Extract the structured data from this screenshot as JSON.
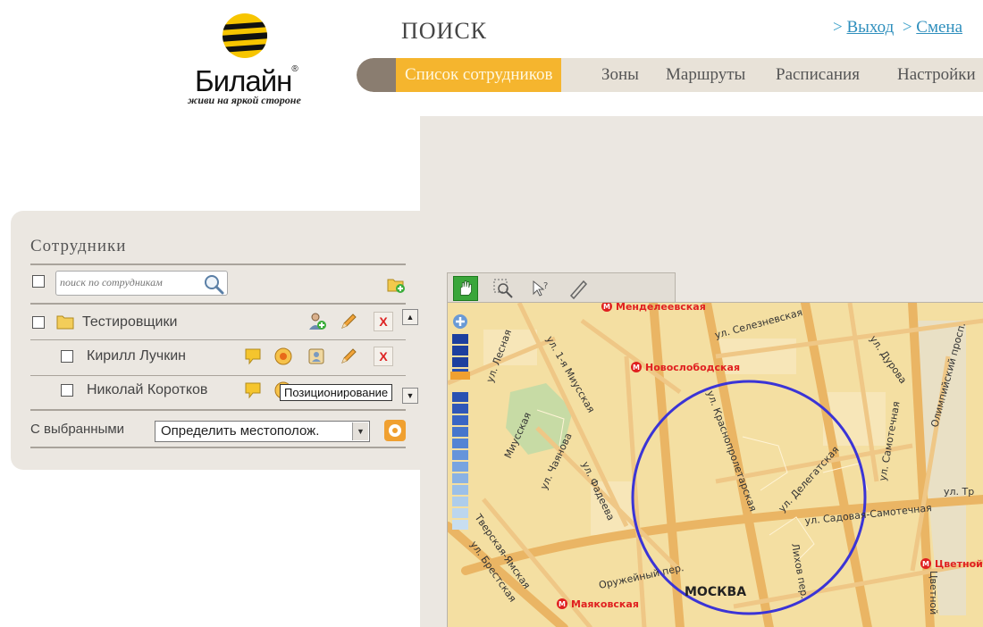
{
  "logo": {
    "brand": "Билайн",
    "reg": "®",
    "slogan": "живи на яркой стороне"
  },
  "header": {
    "title": "ПОИСК",
    "links": [
      {
        "label": "Выход"
      },
      {
        "label": "Смена"
      }
    ]
  },
  "nav": {
    "tabs": [
      {
        "label": "Список сотрудников",
        "active": true
      },
      {
        "label": "Зоны"
      },
      {
        "label": "Маршруты"
      },
      {
        "label": "Расписания"
      },
      {
        "label": "Настройки"
      }
    ]
  },
  "panel": {
    "title": "Сотрудники",
    "search": {
      "placeholder": "поиск по сотрудникам"
    },
    "group": {
      "name": "Тестировщики"
    },
    "employees": [
      {
        "name": "Кирилл Лучкин"
      },
      {
        "name": "Николай Коротков"
      }
    ],
    "tooltip": "Позиционирование",
    "with_selected_label": "С выбранными",
    "action_select": {
      "value": "Определить местополож."
    },
    "remove_symbol": "X"
  },
  "map": {
    "city": "МОСКВА",
    "metro": [
      "Менделеевская",
      "Новослободская",
      "Маяковская",
      "Цветной"
    ],
    "streets": [
      "ул. Селезневская",
      "ул. Дурова",
      "Олимпийский просп.",
      "ул. Самотечная",
      "ул. Лесная",
      "ул. 1-я Миусская",
      "ул. Краснопролетарская",
      "ул. Делегатская",
      "ул. Садовая-Самотечная",
      "Оружейный пер.",
      "Лихов пер.",
      "Миусская",
      "ул. Чаянова",
      "ул. Фадеева",
      "Тверская-Ямская",
      "ул. Брестская",
      "Тверская",
      "ул. Тр",
      "Цветной",
      "Краснопр"
    ]
  },
  "colors": {
    "accent": "#f5b52e",
    "link": "#2f8fbd",
    "map_bg": "#f4dfa2",
    "road": "#eab564",
    "circle": "#3b34d6",
    "metro": "#e02020"
  }
}
